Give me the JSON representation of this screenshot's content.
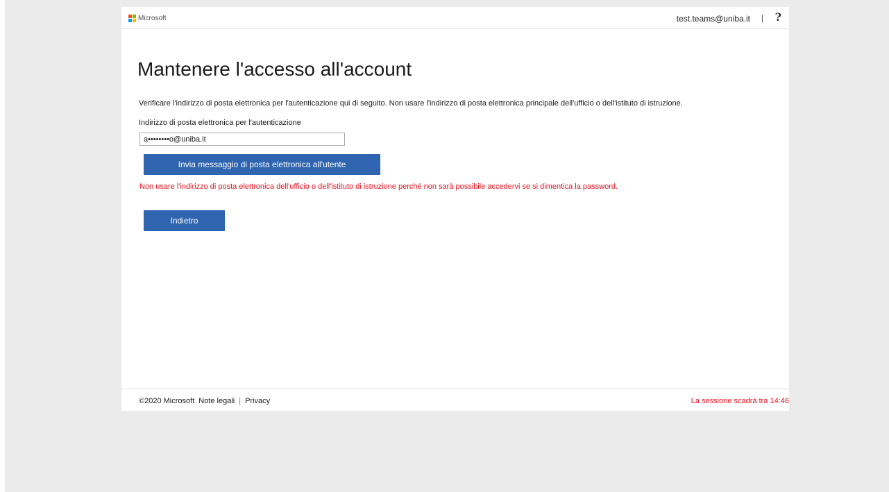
{
  "header": {
    "brand": "Microsoft",
    "user_email": "test.teams@uniba.it",
    "separator": "|",
    "help_icon": "?"
  },
  "main": {
    "title": "Mantenere l'accesso all'account",
    "description": "Verificare l'indirizzo di posta elettronica per l'autenticazione qui di seguito. Non usare l'indirizzo di posta elettronica principale dell'ufficio o dell'istituto di istruzione.",
    "email_label": "Indirizzo di posta elettronica per l'autenticazione",
    "email_value": "a••••••••o@uniba.it",
    "send_button": "Invia messaggio di posta elettronica all'utente",
    "warning": "Non usare l'indirizzo di posta elettronica dell'ufficio o dell'istituto di istruzione perché non sarà possibile accedervi se si dimentica la password.",
    "back_button": "Indietro"
  },
  "footer": {
    "copyright": "©2020 Microsoft",
    "legal_link": "Note legali",
    "separator": "|",
    "privacy_link": "Privacy",
    "session_timer": "La sessione scadrà tra 14:46"
  },
  "colors": {
    "button_blue": "#2f64b1",
    "error_red": "#e8101e",
    "background_gray": "#ebebeb",
    "logo_red": "#f25022",
    "logo_green": "#7fba00",
    "logo_blue": "#00a4ef",
    "logo_yellow": "#ffb900"
  },
  "icons": {
    "logo": "microsoft-logo-icon",
    "help": "help-icon"
  }
}
